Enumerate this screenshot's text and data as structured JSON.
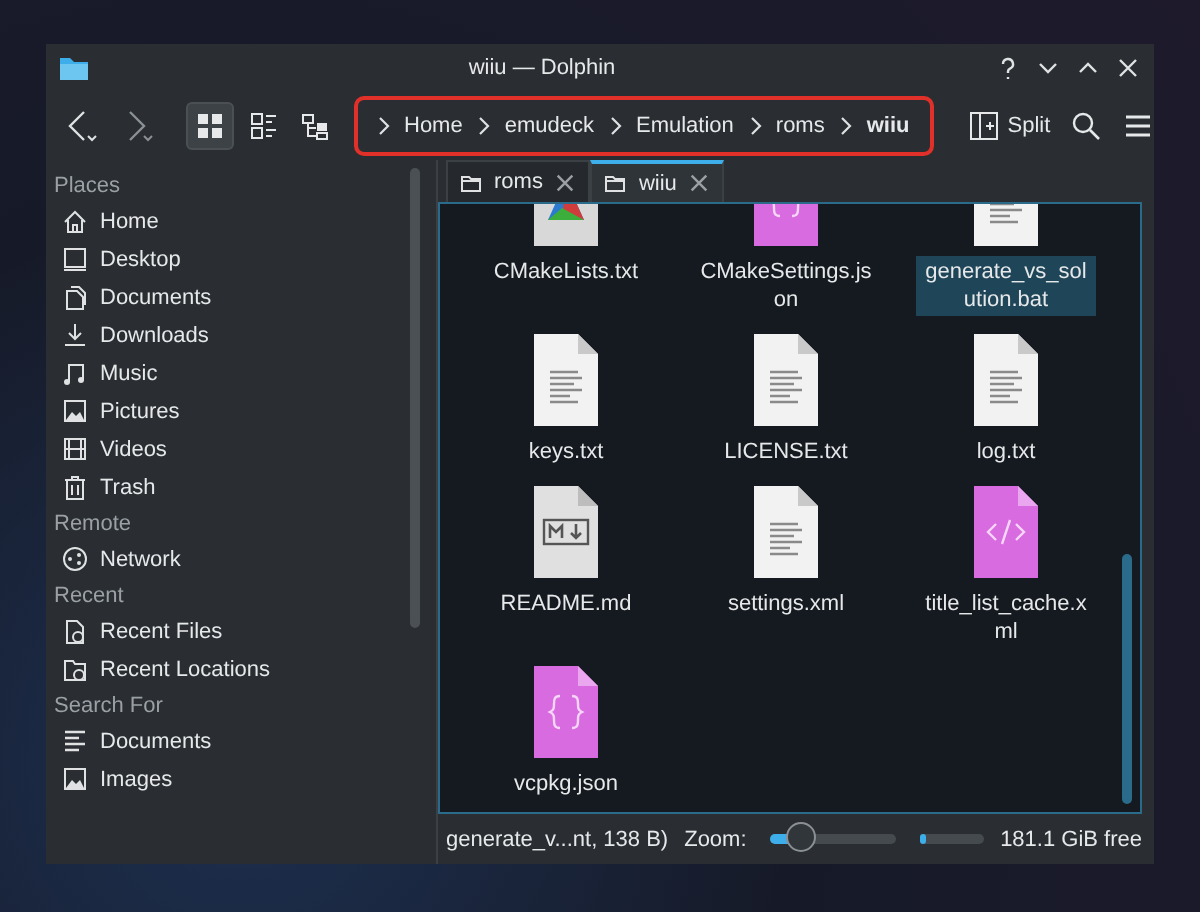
{
  "window": {
    "title": "wiiu — Dolphin"
  },
  "breadcrumb": [
    {
      "label": "Home",
      "selected": false
    },
    {
      "label": "emudeck",
      "selected": false
    },
    {
      "label": "Emulation",
      "selected": false
    },
    {
      "label": "roms",
      "selected": false
    },
    {
      "label": "wiiu",
      "selected": true
    }
  ],
  "toolbar": {
    "split_label": "Split"
  },
  "tabs": [
    {
      "label": "roms",
      "selected": false
    },
    {
      "label": "wiiu",
      "selected": true
    }
  ],
  "sidebar": {
    "sections": [
      {
        "title": "Places",
        "items": [
          {
            "label": "Home",
            "kind": "home"
          },
          {
            "label": "Desktop",
            "kind": "desktop"
          },
          {
            "label": "Documents",
            "kind": "documents"
          },
          {
            "label": "Downloads",
            "kind": "downloads"
          },
          {
            "label": "Music",
            "kind": "music"
          },
          {
            "label": "Pictures",
            "kind": "pictures"
          },
          {
            "label": "Videos",
            "kind": "videos"
          },
          {
            "label": "Trash",
            "kind": "trash"
          }
        ]
      },
      {
        "title": "Remote",
        "items": [
          {
            "label": "Network",
            "kind": "network"
          }
        ]
      },
      {
        "title": "Recent",
        "items": [
          {
            "label": "Recent Files",
            "kind": "recent-files"
          },
          {
            "label": "Recent Locations",
            "kind": "recent-locations"
          }
        ]
      },
      {
        "title": "Search For",
        "items": [
          {
            "label": "Documents",
            "kind": "search-documents"
          },
          {
            "label": "Images",
            "kind": "pictures"
          }
        ]
      }
    ]
  },
  "files": [
    {
      "name": "CMakeLists.txt",
      "kind": "cmake",
      "selected": false
    },
    {
      "name": "CMakeSettings.json",
      "kind": "json",
      "selected": false
    },
    {
      "name": "generate_vs_solution.bat",
      "kind": "text",
      "selected": true
    },
    {
      "name": "keys.txt",
      "kind": "text",
      "selected": false
    },
    {
      "name": "LICENSE.txt",
      "kind": "text",
      "selected": false
    },
    {
      "name": "log.txt",
      "kind": "text",
      "selected": false
    },
    {
      "name": "README.md",
      "kind": "markdown",
      "selected": false
    },
    {
      "name": "settings.xml",
      "kind": "text",
      "selected": false
    },
    {
      "name": "title_list_cache.xml",
      "kind": "xml",
      "selected": false
    },
    {
      "name": "vcpkg.json",
      "kind": "json",
      "selected": false
    }
  ],
  "status_bar": {
    "info": "generate_v...nt, 138 B)",
    "zoom_label": "Zoom:",
    "zoom": {
      "level": 0.25
    },
    "space": {
      "level": 0.1
    },
    "free_space": "181.1 GiB free"
  }
}
